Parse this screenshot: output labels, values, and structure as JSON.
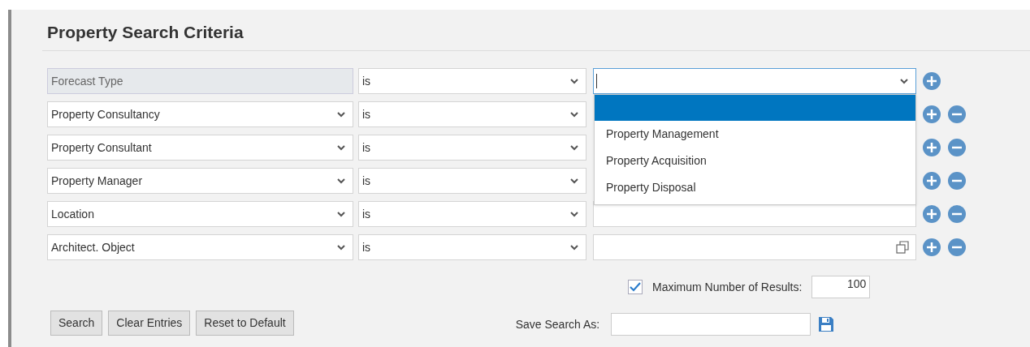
{
  "title": "Property Search Criteria",
  "criteria": [
    {
      "field": {
        "kind": "static",
        "label": "Forecast Type"
      },
      "operator": "is",
      "value": {
        "kind": "select",
        "focused": true
      },
      "removable": false
    },
    {
      "field": {
        "kind": "select",
        "label": "Property Consultancy"
      },
      "operator": "is",
      "removable": true
    },
    {
      "field": {
        "kind": "select",
        "label": "Property Consultant"
      },
      "operator": "is",
      "removable": true
    },
    {
      "field": {
        "kind": "select",
        "label": "Property Manager"
      },
      "operator": "is",
      "removable": true
    },
    {
      "field": {
        "kind": "select",
        "label": "Location"
      },
      "operator": "is",
      "value": {
        "kind": "text",
        "focused": false
      },
      "removable": true
    },
    {
      "field": {
        "kind": "select",
        "label": "Architect. Object"
      },
      "operator": "is",
      "value": {
        "kind": "lookup",
        "focused": false
      },
      "removable": true
    }
  ],
  "dropdown": {
    "blank_row_selected": true,
    "options": [
      {
        "label": "Property Management",
        "selected": false
      },
      {
        "label": "Property Acquisition",
        "selected": false
      },
      {
        "label": "Property Disposal",
        "selected": false
      }
    ]
  },
  "max_results": {
    "checked": true,
    "label": "Maximum Number of Results:",
    "value": "100"
  },
  "buttons": [
    "Search",
    "Clear Entries",
    "Reset to Default"
  ],
  "save_search": {
    "label": "Save Search As:"
  }
}
